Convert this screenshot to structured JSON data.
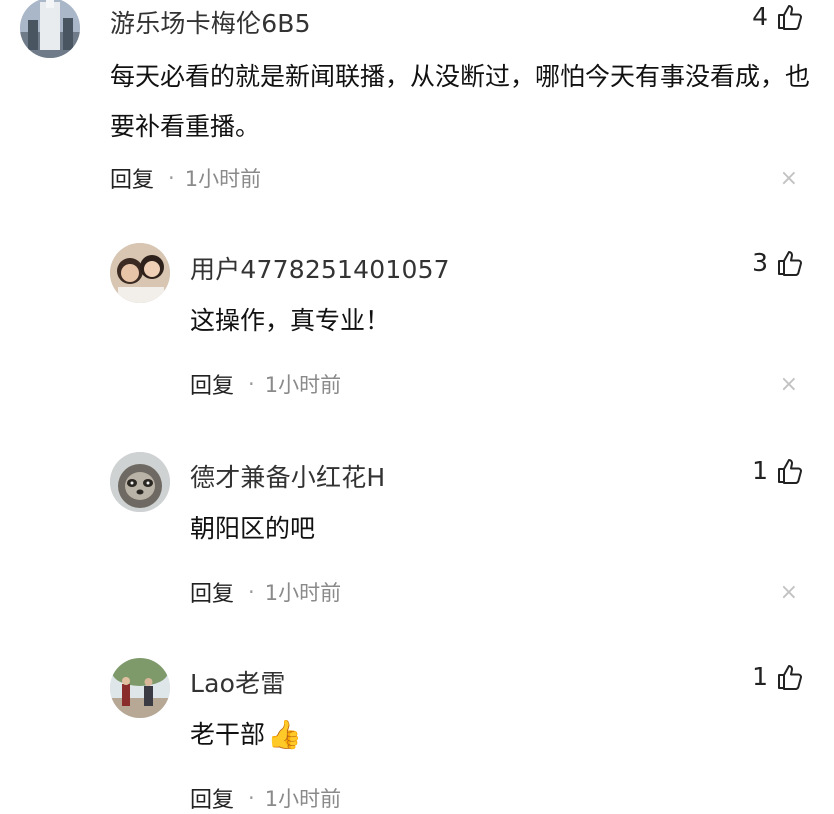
{
  "comments": [
    {
      "username": "游乐场卡梅伦6B5",
      "likes": "4",
      "text": "每天必看的就是新闻联播，从没断过，哪怕今天有事没看成，也要补看重播。",
      "reply_label": "回复",
      "separator": "·",
      "time": "1小时前",
      "avatar_icon": "building-photo-avatar"
    },
    {
      "username": "用户4778251401057",
      "likes": "3",
      "text": "这操作，真专业！",
      "reply_label": "回复",
      "separator": "·",
      "time": "1小时前",
      "avatar_icon": "girls-photo-avatar"
    },
    {
      "username": "德才兼备小红花H",
      "likes": "1",
      "text": "朝阳区的吧",
      "reply_label": "回复",
      "separator": "·",
      "time": "1小时前",
      "avatar_icon": "sloth-photo-avatar"
    },
    {
      "username": "Lao老雷",
      "likes": "1",
      "text": "老干部",
      "emoji": "👍",
      "reply_label": "回复",
      "separator": "·",
      "time": "1小时前",
      "avatar_icon": "outdoor-photo-avatar"
    }
  ],
  "colors": {
    "text": "#111111",
    "meta": "#8a8a8a",
    "close": "#c2c2c2"
  },
  "close_glyph": "×"
}
